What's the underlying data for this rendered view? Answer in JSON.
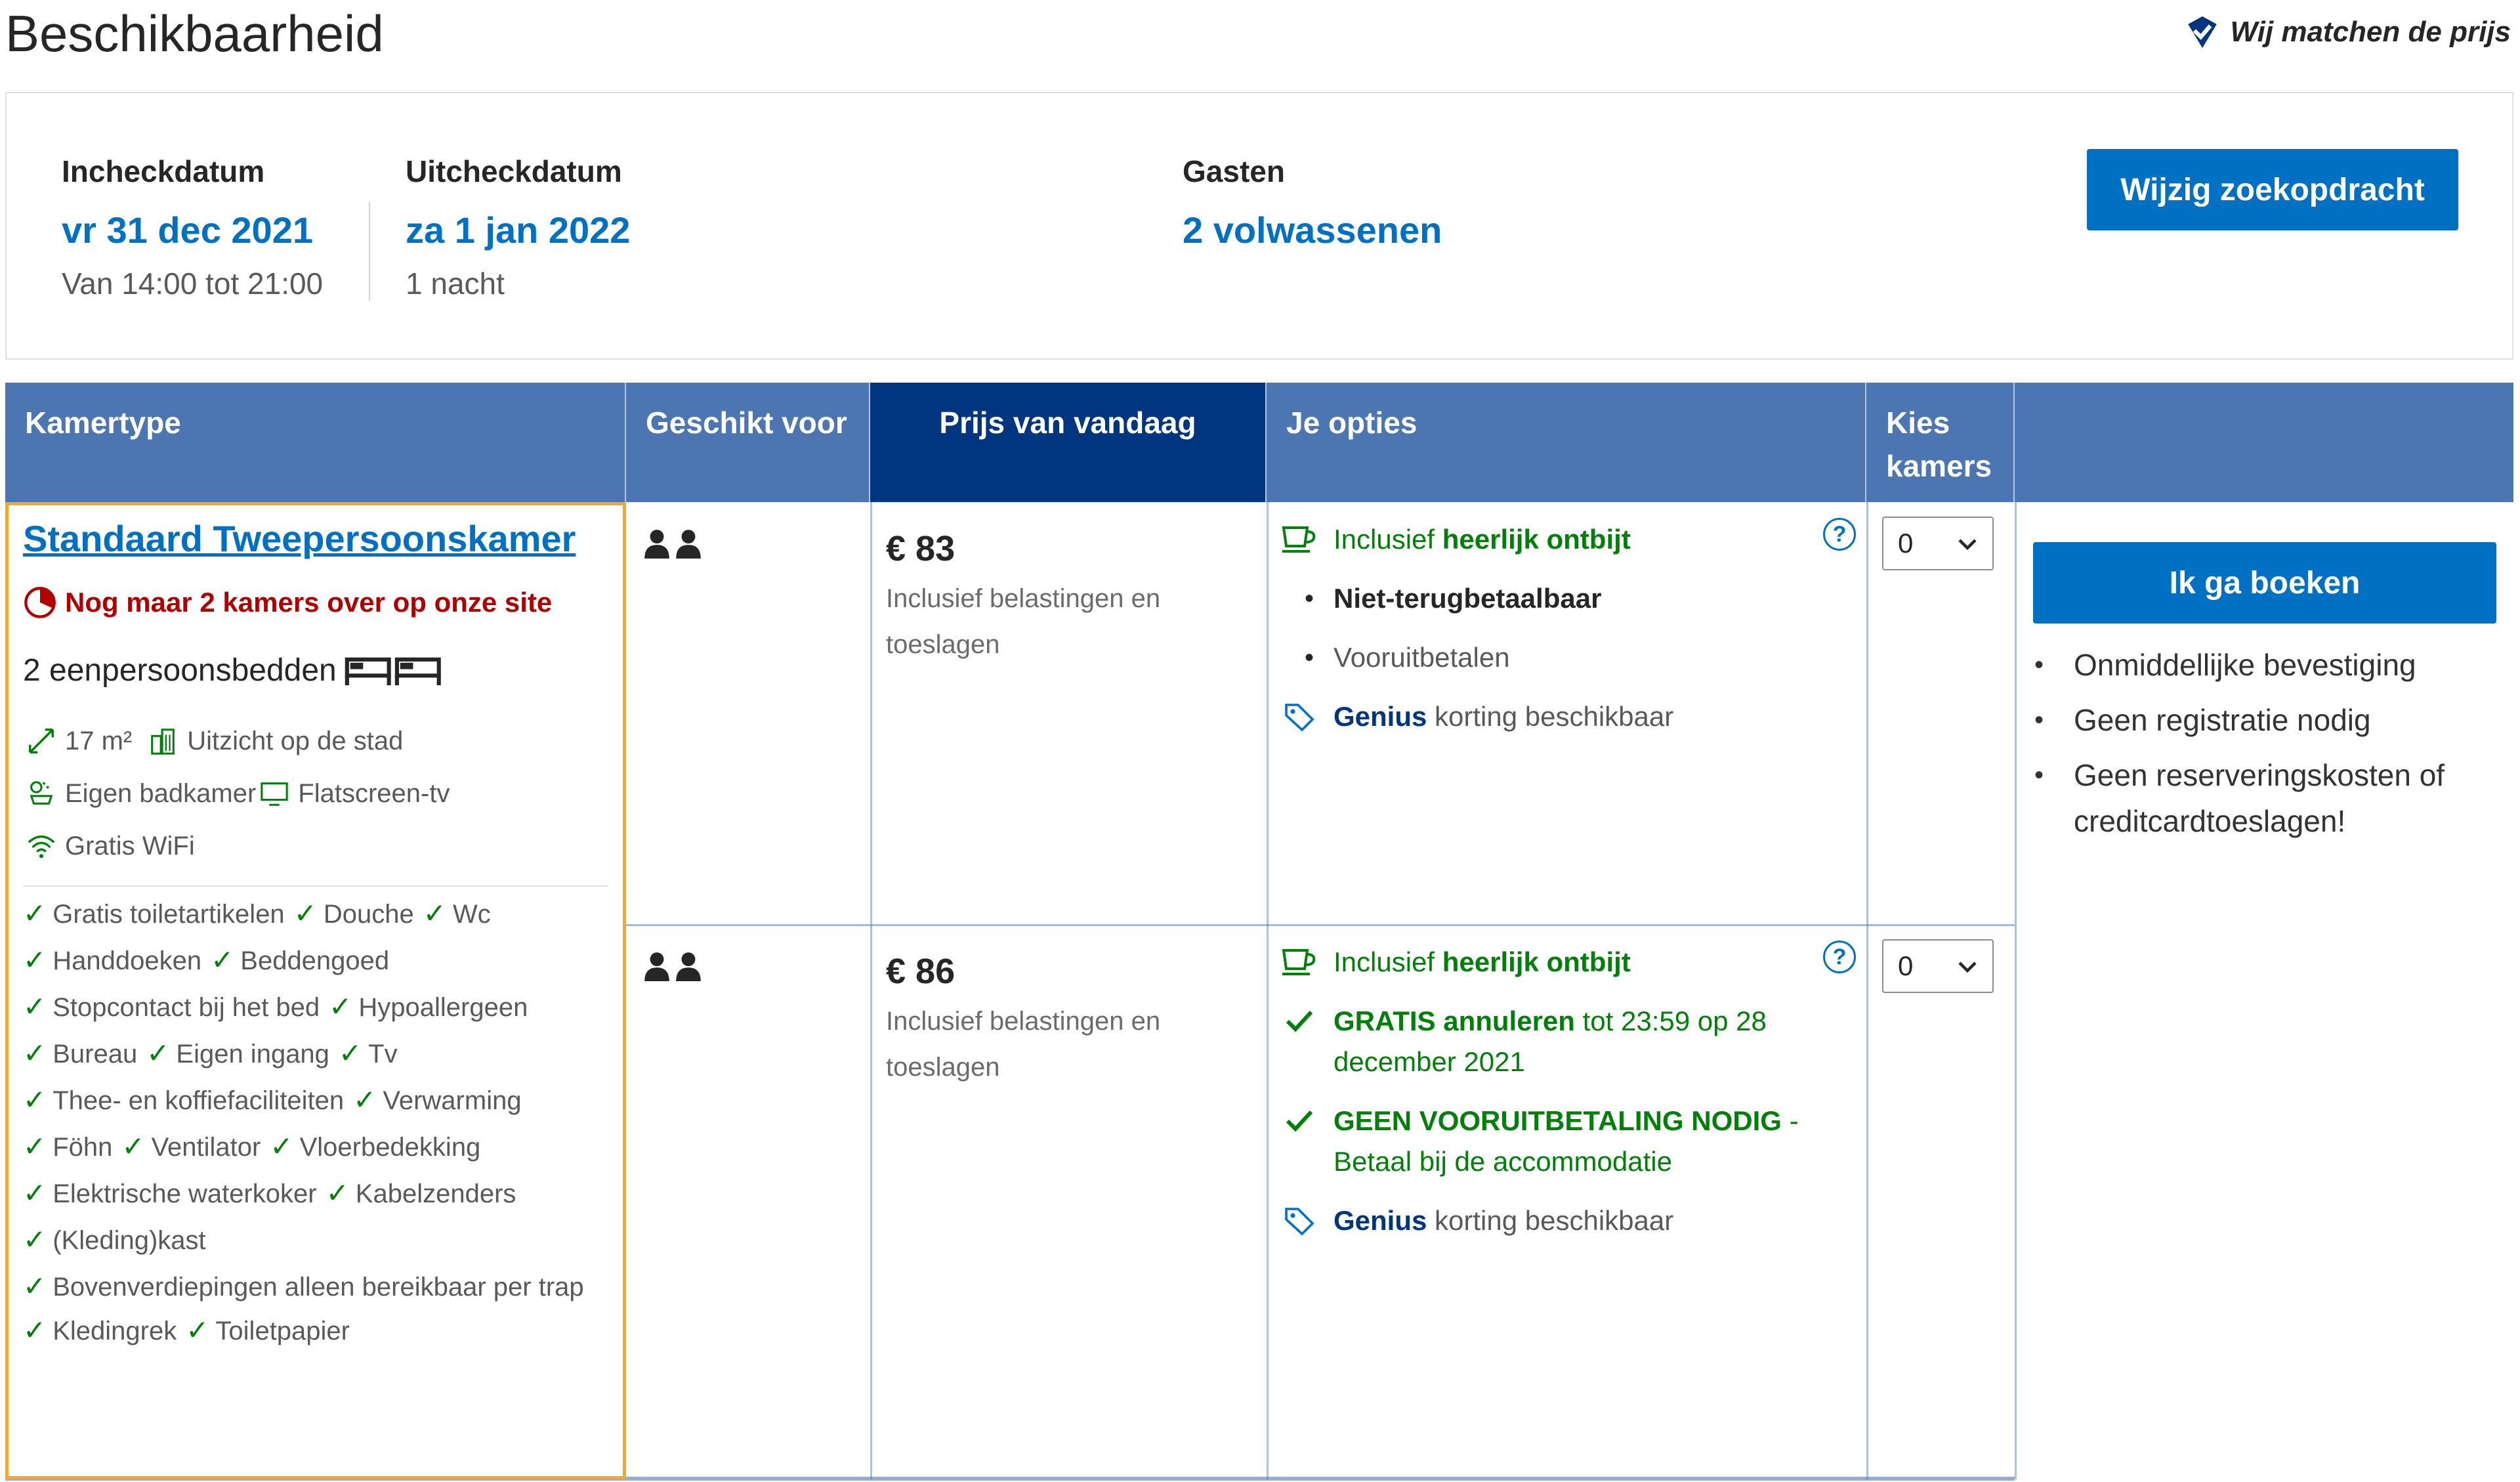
{
  "page_title": "Beschikbaarheid",
  "price_match": {
    "label": "Wij matchen de prijs",
    "icon": "shield-check-icon"
  },
  "search": {
    "checkin": {
      "label": "Incheckdatum",
      "value": "vr 31 dec 2021",
      "sub": "Van 14:00 tot 21:00"
    },
    "checkout": {
      "label": "Uitcheckdatum",
      "value": "za 1 jan 2022",
      "sub": "1 nacht"
    },
    "guests": {
      "label": "Gasten",
      "value": "2 volwassenen"
    },
    "change_button": "Wijzig zoekopdracht"
  },
  "table": {
    "headers": {
      "room_type": "Kamertype",
      "suitable_for": "Geschikt voor",
      "price_today": "Prijs van vandaag",
      "options": "Je opties",
      "select_rooms": "Kies kamers"
    },
    "room": {
      "name": "Standaard Tweepersoonskamer",
      "scarcity": "Nog maar 2 kamers over op onze site",
      "beds": "2 eenpersoonsbedden",
      "size": "17 m²",
      "view": "Uitzicht op de stad",
      "bathroom": "Eigen badkamer",
      "tv": "Flatscreen-tv",
      "wifi": "Gratis WiFi",
      "amenities": [
        [
          "Gratis toiletartikelen",
          "Douche",
          "Wc"
        ],
        [
          "Handdoeken",
          "Beddengoed"
        ],
        [
          "Stopcontact bij het bed",
          "Hypoallergeen"
        ],
        [
          "Bureau",
          "Eigen ingang",
          "Tv"
        ],
        [
          "Thee- en koffiefaciliteiten",
          "Verwarming"
        ],
        [
          "Föhn",
          "Ventilator",
          "Vloerbedekking"
        ],
        [
          "Elektrische waterkoker",
          "Kabelzenders"
        ],
        [
          "(Kleding)kast"
        ],
        [
          "Bovenverdiepingen alleen bereikbaar per trap"
        ],
        [
          "Kledingrek",
          "Toiletpapier"
        ]
      ]
    },
    "rows": [
      {
        "price": "€ 83",
        "price_note": "Inclusief belastingen en toeslagen",
        "breakfast_prefix": "Inclusief ",
        "breakfast_bold": "heerlijk ontbijt",
        "policy_1": "Niet-terugbetaalbaar",
        "policy_2": "Vooruitbetalen",
        "genius": "Genius",
        "genius_suffix": " korting beschikbaar",
        "rooms_selected": "0"
      },
      {
        "price": "€ 86",
        "price_note": "Inclusief belastingen en toeslagen",
        "breakfast_prefix": "Inclusief ",
        "breakfast_bold": "heerlijk ontbijt",
        "cancel_bold": "GRATIS annuleren",
        "cancel_rest": " tot 23:59 op 28 december 2021",
        "prepay_bold": "GEEN VOORUITBETALING NODIG",
        "prepay_rest": " - Betaal bij de accommodatie",
        "genius": "Genius",
        "genius_suffix": " korting beschikbaar",
        "rooms_selected": "0"
      }
    ],
    "help_icon": "?",
    "book_button": "Ik ga boeken",
    "perks": [
      "Onmiddellijke bevestiging",
      "Geen registratie nodig",
      "Geen reserveringskosten of creditcardtoeslagen!"
    ]
  },
  "colors": {
    "brand_blue": "#0071c2",
    "header_blue": "#4c76b2",
    "dark_blue": "#003580",
    "green": "#008009",
    "red": "#b00000",
    "highlight_orange": "#f0a830"
  }
}
